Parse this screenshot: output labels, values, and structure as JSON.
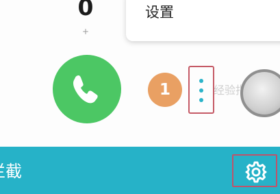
{
  "dialpad": {
    "digit": "0",
    "digit_sub": "+"
  },
  "menu": {
    "items": [
      {
        "label": "设置"
      }
    ]
  },
  "call_row": {
    "sim_badge": "1",
    "watermark_text": "经验指南"
  },
  "bottom_bar": {
    "title": "拦截"
  },
  "icons": {
    "call": "phone-handset-icon",
    "more": "three-dots-vertical-icon",
    "settings": "gear-icon"
  },
  "colors": {
    "call_green": "#4cc764",
    "sim_orange": "#e9a063",
    "accent_teal": "#26b2c8",
    "highlight_red": "#c55a66"
  }
}
